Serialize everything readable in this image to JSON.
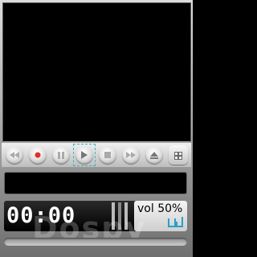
{
  "player": {
    "track_title": "",
    "time": "00:00",
    "volume_label": "vol 50%",
    "volume_level": 0.5,
    "seek_progress": 0
  },
  "controls": {
    "items": [
      {
        "name": "rewind-button",
        "icon": "rewind-icon"
      },
      {
        "name": "record-button",
        "icon": "record-icon"
      },
      {
        "name": "pause-button",
        "icon": "pause-icon"
      },
      {
        "name": "play-button",
        "icon": "play-icon",
        "focused": true
      },
      {
        "name": "stop-button",
        "icon": "stop-icon"
      },
      {
        "name": "fast-forward-button",
        "icon": "fast-forward-icon"
      },
      {
        "name": "eject-button",
        "icon": "eject-icon"
      },
      {
        "name": "menu-button",
        "icon": "grid-menu-icon"
      }
    ]
  },
  "watermark": "Dospy",
  "colors": {
    "focus": "#3fb5c8",
    "record": "#e0302a",
    "volume_indicator": "#2aa0c8"
  }
}
